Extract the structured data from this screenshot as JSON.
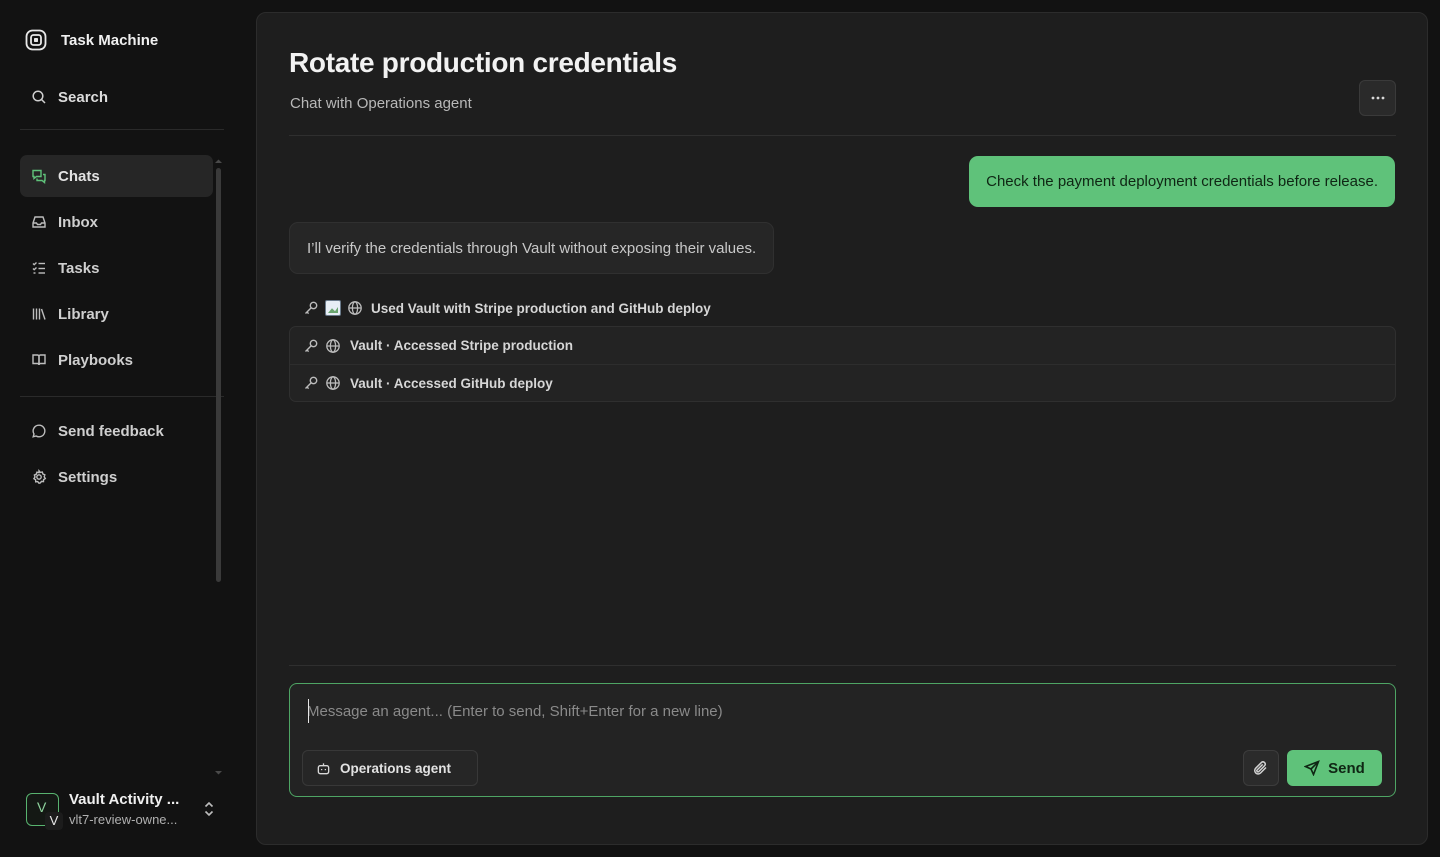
{
  "sidebar": {
    "brand": "Task Machine",
    "search_label": "Search",
    "items": [
      {
        "label": "Chats",
        "icon": "chats-icon",
        "active": true
      },
      {
        "label": "Inbox",
        "icon": "inbox-icon",
        "active": false
      },
      {
        "label": "Tasks",
        "icon": "tasks-icon",
        "active": false
      },
      {
        "label": "Library",
        "icon": "library-icon",
        "active": false
      },
      {
        "label": "Playbooks",
        "icon": "playbooks-icon",
        "active": false
      }
    ],
    "secondary_items": [
      {
        "label": "Send feedback",
        "icon": "message-circle-icon"
      },
      {
        "label": "Settings",
        "icon": "gear-icon"
      }
    ],
    "account": {
      "avatar_letter": "V",
      "avatar_badge": "V",
      "name": "Vault Activity ...",
      "subtitle": "vlt7-review-owne..."
    }
  },
  "main": {
    "title": "Rotate production credentials",
    "subtitle": "Chat with Operations agent",
    "more_label": "···",
    "messages": {
      "user": "Check the payment deployment credentials before release.",
      "agent": "I’ll verify the credentials through Vault without exposing their values."
    },
    "tool_summary": "Used Vault with Stripe production and GitHub deploy",
    "tool_calls": [
      {
        "label": "Vault · Accessed Stripe production"
      },
      {
        "label": "Vault · Accessed GitHub deploy"
      }
    ],
    "composer": {
      "placeholder": "Message an agent... (Enter to send, Shift+Enter for a new line)",
      "value": "",
      "agent_label": "Operations agent",
      "send_label": "Send"
    }
  },
  "colors": {
    "accent": "#5fc27a",
    "background": "#121212",
    "panel": "#1e1e1e"
  }
}
